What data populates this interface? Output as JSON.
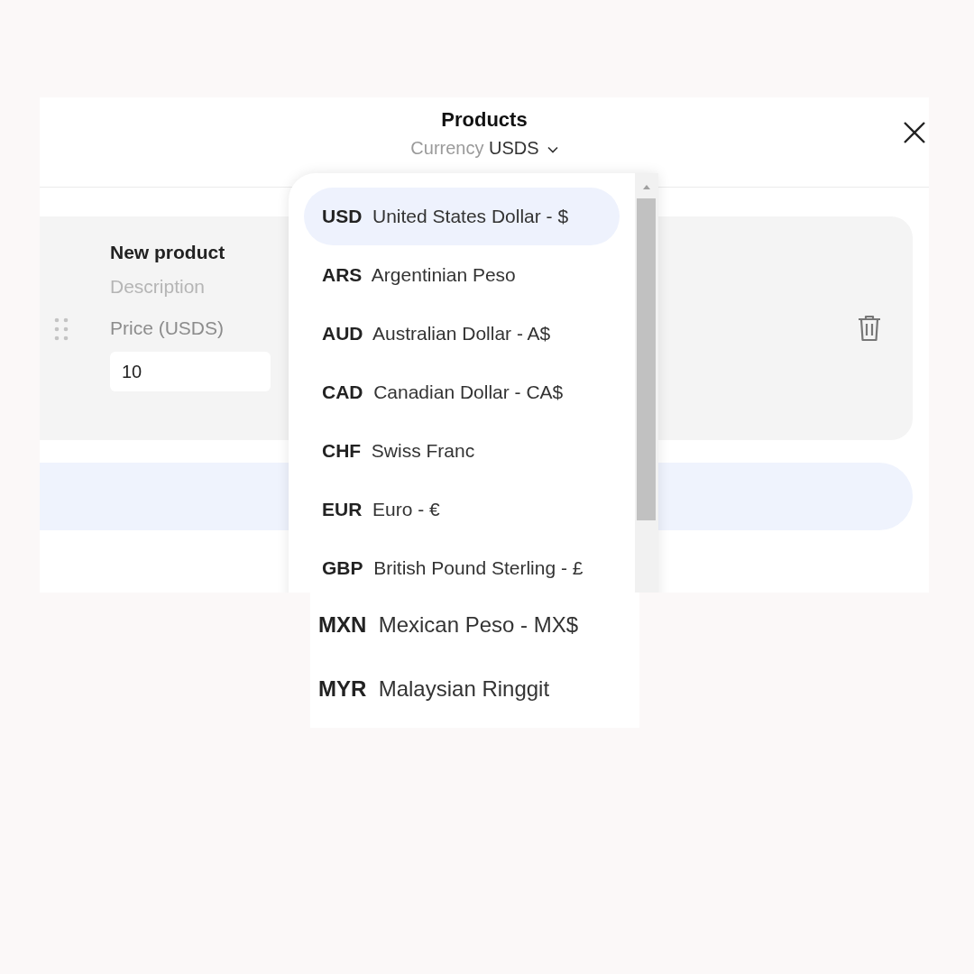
{
  "dialog": {
    "title": "Products",
    "currency_label": "Currency",
    "currency_value": "USDS"
  },
  "product": {
    "name": "New product",
    "description_placeholder": "Description",
    "price_label": "Price (USDS)",
    "price_value": "10"
  },
  "currency_dropdown": {
    "options": [
      {
        "code": "USD",
        "name": "United States Dollar - $",
        "selected": true
      },
      {
        "code": "ARS",
        "name": "Argentinian Peso",
        "selected": false
      },
      {
        "code": "AUD",
        "name": "Australian Dollar - A$",
        "selected": false
      },
      {
        "code": "CAD",
        "name": "Canadian Dollar - CA$",
        "selected": false
      },
      {
        "code": "CHF",
        "name": "Swiss Franc",
        "selected": false
      },
      {
        "code": "EUR",
        "name": "Euro - €",
        "selected": false
      },
      {
        "code": "GBP",
        "name": "British Pound Sterling - £",
        "selected": false
      }
    ]
  },
  "currency_list_continuation": {
    "options": [
      {
        "code": "MXN",
        "name": "Mexican Peso - MX$",
        "selected": false
      },
      {
        "code": "MYR",
        "name": "Malaysian Ringgit",
        "selected": false
      }
    ]
  }
}
